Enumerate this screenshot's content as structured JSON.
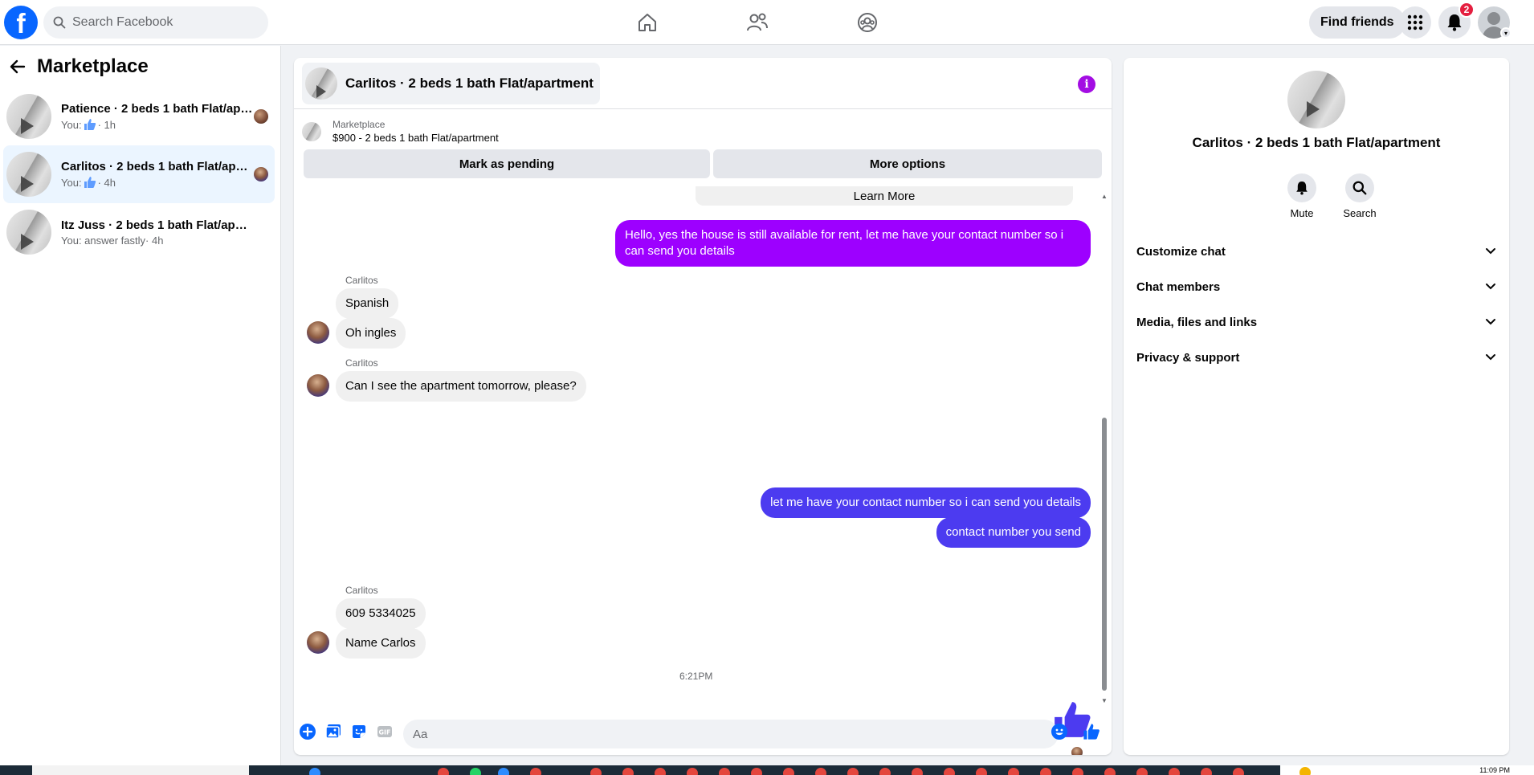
{
  "topbar": {
    "logo": "f",
    "search_placeholder": "Search Facebook",
    "find_friends_label": "Find friends",
    "notification_count": "2",
    "icons": [
      "home-icon",
      "friends-icon",
      "groups-icon",
      "menu-grid-icon",
      "bell-icon"
    ]
  },
  "sidebar": {
    "title": "Marketplace",
    "conversations": [
      {
        "title": "Patience · 2 beds 1 bath Flat/apartment",
        "prefix": "You:",
        "meta": "· 1h",
        "has_like": true
      },
      {
        "title": "Carlitos · 2 beds 1 bath Flat/apartment",
        "prefix": "You:",
        "meta": "· 4h",
        "has_like": true
      },
      {
        "title": "Itz Juss · 2 beds 1 bath Flat/apartment",
        "prefix": "You: answer fastly",
        "meta": "· 4h",
        "has_like": false
      }
    ]
  },
  "chat": {
    "title": "Carlitos · 2 beds 1 bath Flat/apartment",
    "marketplace_label": "Marketplace",
    "listing": "$900 - 2 beds 1 bath Flat/apartment",
    "mark_pending_label": "Mark as pending",
    "more_options_label": "More options",
    "learn_more_label": "Learn More",
    "sender_name": "Carlitos",
    "messages": {
      "out1": "Hello, yes the house is still available for rent, let me have your contact number so i can send you details",
      "in1": "Spanish",
      "in2": "Oh ingles",
      "in3": "Can I see the apartment tomorrow, please?",
      "out2": "let me have your contact number so i can send you details",
      "out3": "contact number you send",
      "in4": "609 5334025",
      "in5": "Name Carlos"
    },
    "timestamp": "6:21PM",
    "composer_placeholder": "Aa"
  },
  "details": {
    "title": "Carlitos · 2 beds 1 bath Flat/apartment",
    "mute_label": "Mute",
    "search_label": "Search",
    "rows": [
      "Customize chat",
      "Chat members",
      "Media, files and links",
      "Privacy & support"
    ]
  },
  "taskbar": {
    "time": "11:09 PM"
  },
  "colors": {
    "brand": "#0866ff",
    "outgoing_purple": "#9d00ff",
    "outgoing_blue": "#4c3bf0",
    "info": "#a30de3"
  }
}
